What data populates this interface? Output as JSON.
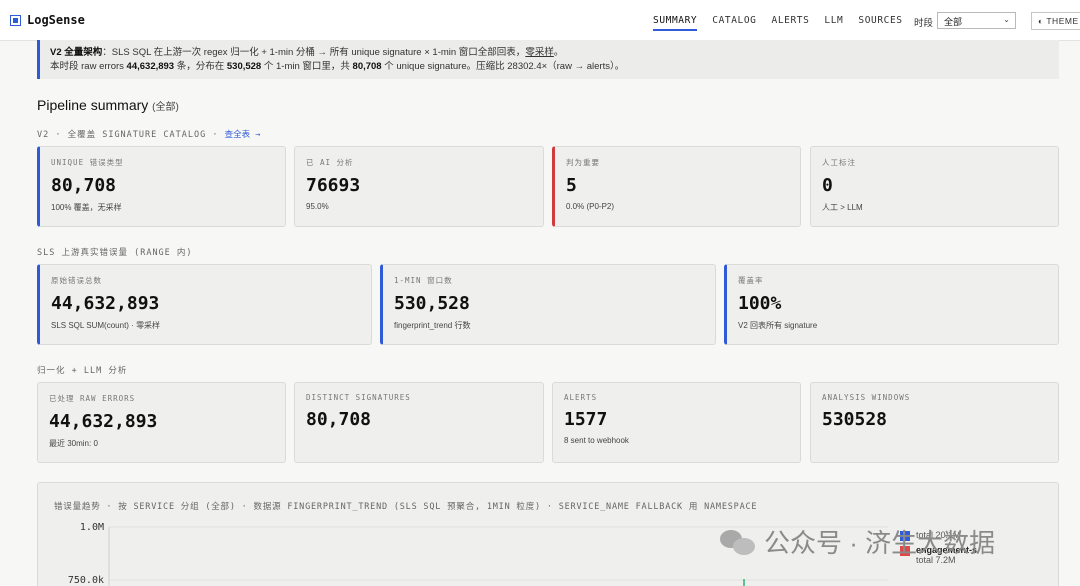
{
  "app": {
    "name": "LogSense"
  },
  "nav": [
    {
      "label": "SUMMARY",
      "active": true
    },
    {
      "label": "CATALOG",
      "active": false
    },
    {
      "label": "ALERTS",
      "active": false
    },
    {
      "label": "LLM",
      "active": false
    },
    {
      "label": "SOURCES",
      "active": false
    }
  ],
  "range": {
    "label": "时段",
    "value": "全部"
  },
  "theme": {
    "label": "THEME"
  },
  "notice": {
    "line1_prefix": "V2 全量架构",
    "line1_body": "：SLS SQL 在上游一次 regex 归一化 + 1-min 分桶 → 所有 unique signature × 1-min 窗口全部回表，",
    "line1_link": "零采样",
    "line1_end": "。",
    "line2_a": "本时段 raw errors ",
    "line2_raw": "44,632,893",
    "line2_b": " 条，分布在 ",
    "line2_windows": "530,528",
    "line2_c": " 个 1-min 窗口里，共 ",
    "line2_sigs": "80,708",
    "line2_d": " 个 unique signature。压缩比 28302.4×（raw → alerts）。"
  },
  "summary": {
    "title": "Pipeline summary",
    "subtitle": "(全部)"
  },
  "catalog_section": {
    "caption": "V2 · 全覆盖 SIGNATURE CATALOG · ",
    "link": "查全表 →",
    "cards": [
      {
        "label": "UNIQUE 错误类型",
        "value": "80,708",
        "note": "100% 覆盖，无采样"
      },
      {
        "label": "已 AI 分析",
        "value": "76693",
        "note": "95.0%"
      },
      {
        "label": "判为重要",
        "value": "5",
        "note": "0.0% (P0-P2)"
      },
      {
        "label": "人工标注",
        "value": "0",
        "note": "人工 > LLM"
      }
    ]
  },
  "sls_section": {
    "caption": "SLS 上游真实错误量 (RANGE 内)",
    "cards": [
      {
        "label": "原始错误总数",
        "value": "44,632,893",
        "note": "SLS SQL SUM(count) · 零采样"
      },
      {
        "label": "1-MIN 窗口数",
        "value": "530,528",
        "note": "fingerprint_trend 行数"
      },
      {
        "label": "覆盖率",
        "value": "100%",
        "note": "V2 回表所有 signature"
      }
    ]
  },
  "llm_section": {
    "caption": "归一化 + LLM 分析",
    "cards": [
      {
        "label": "已处理 RAW ERRORS",
        "value": "44,632,893",
        "note": "最近 30min: 0"
      },
      {
        "label": "DISTINCT SIGNATURES",
        "value": "80,708",
        "note": ""
      },
      {
        "label": "ALERTS",
        "value": "1577",
        "note": "8 sent to webhook"
      },
      {
        "label": "ANALYSIS WINDOWS",
        "value": "530528",
        "note": ""
      }
    ]
  },
  "chart": {
    "title": "错误量趋势 · 按 SERVICE 分组 (全部) · 数据源 FINGERPRINT_TREND (SLS SQL 预聚合, 1MIN 粒度) · SERVICE_NAME FALLBACK 用 NAMESPACE",
    "legend": [
      {
        "name": "",
        "total": "total 20.1M",
        "color": "#2f5bd8"
      },
      {
        "name": "engagement-s",
        "total": "total 7.2M",
        "color": "#e04848"
      }
    ]
  },
  "chart_data": {
    "type": "line",
    "ylabels": [
      "1.0M",
      "750.0k"
    ],
    "ylim": [
      0,
      1000000
    ],
    "series": [
      {
        "name": "",
        "total": "20.1M"
      },
      {
        "name": "engagement-s",
        "total": "7.2M"
      }
    ]
  },
  "watermark": {
    "text": "公众号 · 济生大数据"
  }
}
